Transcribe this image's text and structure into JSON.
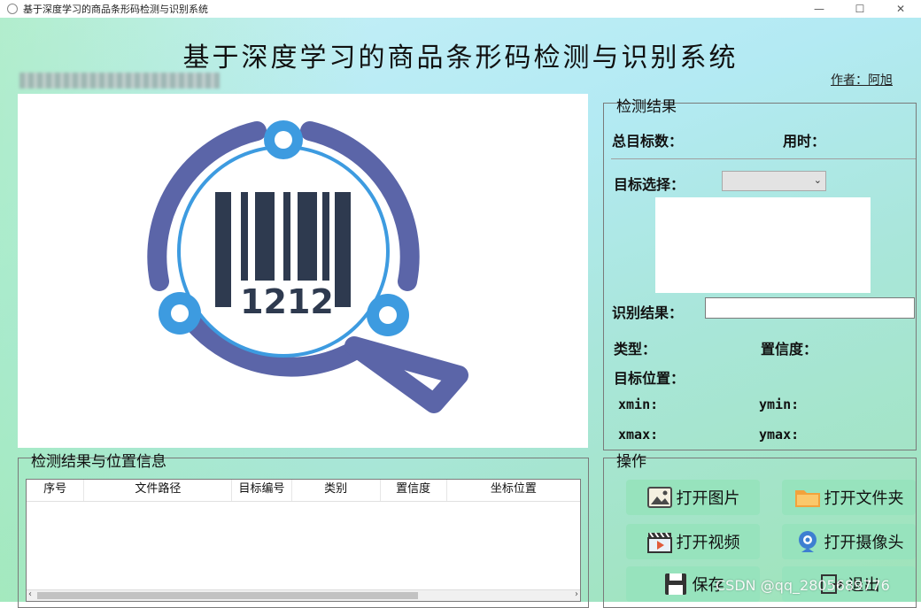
{
  "window": {
    "title": "基于深度学习的商品条形码检测与识别系统",
    "controls": [
      "—",
      "☐",
      "✕"
    ]
  },
  "header": {
    "title": "基于深度学习的商品条形码检测与识别系统",
    "author": "作者：阿旭"
  },
  "display": {
    "logo_digits": "1212",
    "colors": {
      "ring": "#5b65a8",
      "accent": "#3d9be0",
      "bars": "#2e3a4f"
    }
  },
  "result_panel": {
    "group_title": "检测结果",
    "total_label": "总目标数：",
    "time_label": "用时：",
    "target_select_label": "目标选择：",
    "target_select_value": "",
    "recog_label": "识别结果：",
    "recog_value": "",
    "type_label": "类型：",
    "conf_label": "置信度：",
    "pos_label": "目标位置：",
    "xmin_label": "xmin:",
    "ymin_label": "ymin:",
    "xmax_label": "xmax:",
    "ymax_label": "ymax:"
  },
  "info_table": {
    "group_title": "检测结果与位置信息",
    "columns": [
      "序号",
      "文件路径",
      "目标编号",
      "类别",
      "置信度",
      "坐标位置"
    ],
    "rows": []
  },
  "operations": {
    "group_title": "操作",
    "open_image": "打开图片",
    "open_folder": "打开文件夹",
    "open_video": "打开视频",
    "open_camera": "打开摄像头",
    "save": "保存",
    "exit": "退出"
  },
  "watermark": "CSDN @qq_28056",
  "watermark_tail": "89776"
}
